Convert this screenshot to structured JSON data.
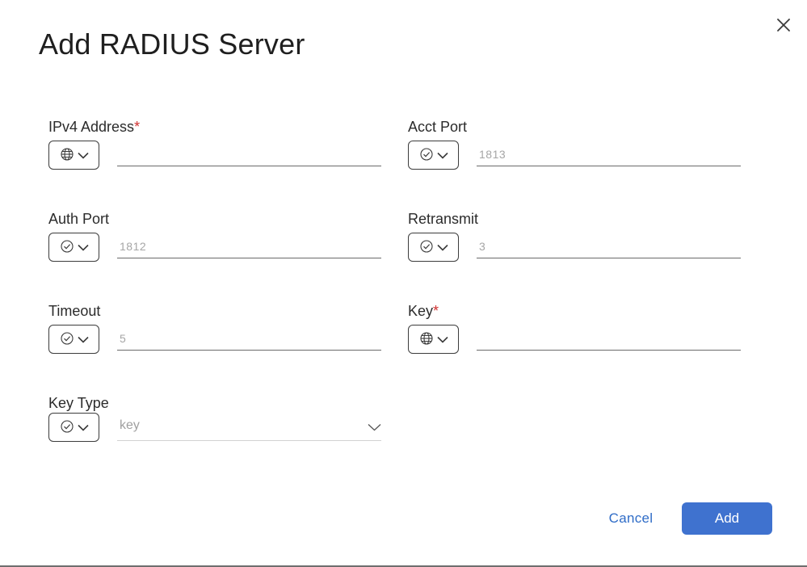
{
  "dialog": {
    "title": "Add RADIUS Server",
    "close_icon": "close-icon"
  },
  "fields": {
    "ipv4": {
      "label": "IPv4 Address",
      "required_mark": "*",
      "scope_icon": "globe-icon",
      "value": "",
      "placeholder": ""
    },
    "acct_port": {
      "label": "Acct Port",
      "scope_icon": "check-circle-icon",
      "value": "",
      "placeholder": "1813"
    },
    "auth_port": {
      "label": "Auth Port",
      "scope_icon": "check-circle-icon",
      "value": "",
      "placeholder": "1812"
    },
    "retransmit": {
      "label": "Retransmit",
      "scope_icon": "check-circle-icon",
      "value": "",
      "placeholder": "3"
    },
    "timeout": {
      "label": "Timeout",
      "scope_icon": "check-circle-icon",
      "value": "",
      "placeholder": "5"
    },
    "key": {
      "label": "Key",
      "required_mark": "*",
      "scope_icon": "globe-icon",
      "value": "",
      "placeholder": ""
    },
    "key_type": {
      "label": "Key Type",
      "scope_icon": "check-circle-icon",
      "selected": "key"
    }
  },
  "footer": {
    "cancel_label": "Cancel",
    "add_label": "Add"
  },
  "colors": {
    "primary": "#3f72cf",
    "link": "#2f6cc7",
    "required": "#d0302f",
    "placeholder": "#a6a6a6"
  }
}
